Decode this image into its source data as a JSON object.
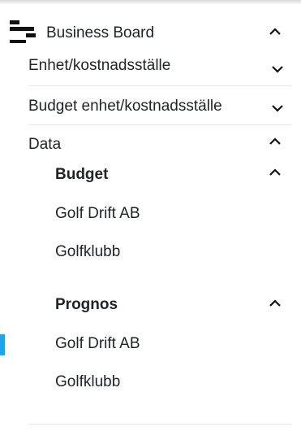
{
  "nav": {
    "business_board": {
      "label": "Business Board",
      "icon": "business-board-icon",
      "state": "expanded"
    },
    "enhet": {
      "label": "Enhet/kostnadsställe",
      "state": "collapsed"
    },
    "budget_enhet": {
      "label": "Budget enhet/kostnadsställe",
      "state": "collapsed"
    },
    "data": {
      "label": "Data",
      "state": "expanded",
      "groups": [
        {
          "label": "Budget",
          "state": "expanded",
          "items": [
            "Golf Drift AB",
            "Golfklubb"
          ]
        },
        {
          "label": "Prognos",
          "state": "expanded",
          "items": [
            "Golf Drift AB",
            "Golfklubb"
          ]
        }
      ]
    }
  },
  "active_item": "Prognos / Golf Drift AB",
  "colors": {
    "accent": "#1aa7e6",
    "text": "#1f2328",
    "divider": "#e6e6e6"
  }
}
